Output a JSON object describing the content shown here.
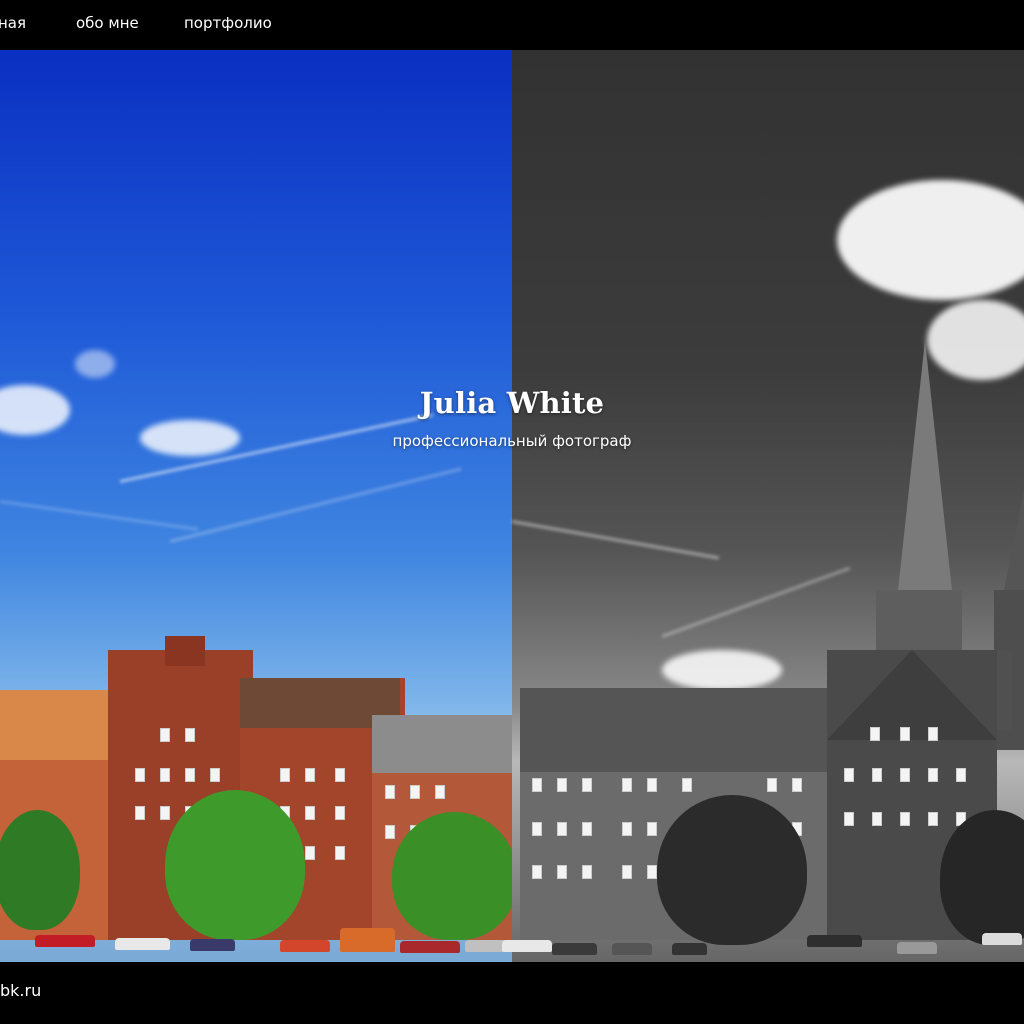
{
  "nav": {
    "items": [
      {
        "label": "ная"
      },
      {
        "label": "обо мне"
      },
      {
        "label": "портфолио"
      }
    ]
  },
  "hero": {
    "title": "Julia White",
    "subtitle": "профессиональный фотограф"
  },
  "footer": {
    "text": "bk.ru"
  },
  "colors": {
    "background": "#000000",
    "text": "#ffffff",
    "sky_color": "#0a2fc2",
    "sky_bw": "#323232"
  }
}
